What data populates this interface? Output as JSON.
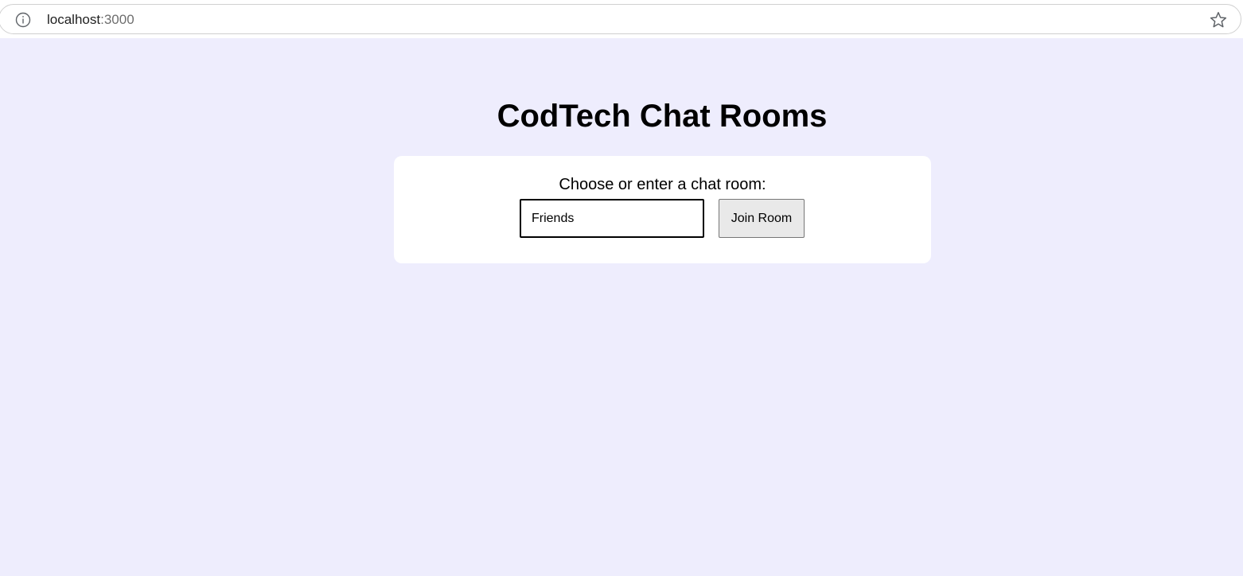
{
  "browser": {
    "url_host": "localhost",
    "url_port": ":3000",
    "info_icon": "info-icon",
    "bookmark_icon": "star-icon"
  },
  "page": {
    "title": "CodTech Chat Rooms",
    "background_color": "#eeedfd",
    "room_form": {
      "prompt": "Choose or enter a chat room:",
      "room_input_value": "Friends",
      "join_button_label": "Join Room"
    }
  }
}
